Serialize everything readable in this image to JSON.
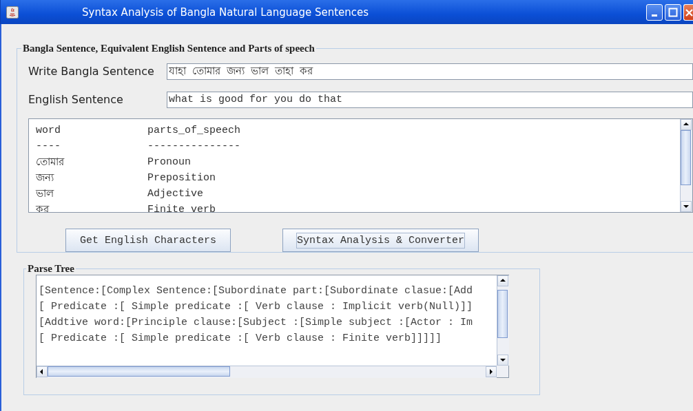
{
  "window": {
    "title": "Syntax Analysis of Bangla Natural Language Sentences"
  },
  "input_panel": {
    "title": "Bangla Sentence, Equivalent English Sentence and Parts of speech",
    "fields": [
      {
        "label": "Write Bangla Sentence",
        "value": "যাহা তোমার জন্য ভাল তাহা কর"
      },
      {
        "label": "English Sentence",
        "value": "what is good for you do that"
      }
    ],
    "pos_table": {
      "header": {
        "word": "word",
        "pos": "parts_of_speech"
      },
      "separator": {
        "word": "----",
        "pos": "---------------"
      },
      "rows": [
        {
          "word": "তোমার",
          "pos": "Pronoun"
        },
        {
          "word": "জন্য",
          "pos": "Preposition"
        },
        {
          "word": "ভাল",
          "pos": "Adjective"
        },
        {
          "word": "কর",
          "pos": "Finite verb"
        }
      ]
    },
    "buttons": [
      {
        "label": "Get English Characters",
        "focused": false
      },
      {
        "label": "Syntax Analysis & Converter",
        "focused": true
      }
    ]
  },
  "parse_tree": {
    "title": "Parse Tree",
    "lines": [
      "[Sentence:[Complex Sentence:[Subordinate part:[Subordinate clasue:[Add",
      "[ Predicate :[ Simple predicate :[ Verb clause : Implicit verb(Null)]]",
      "[Addtive word:[Principle clause:[Subject :[Simple subject :[Actor : Im",
      "[ Predicate :[ Simple predicate :[ Verb clause : Finite verb]]]]]"
    ]
  }
}
